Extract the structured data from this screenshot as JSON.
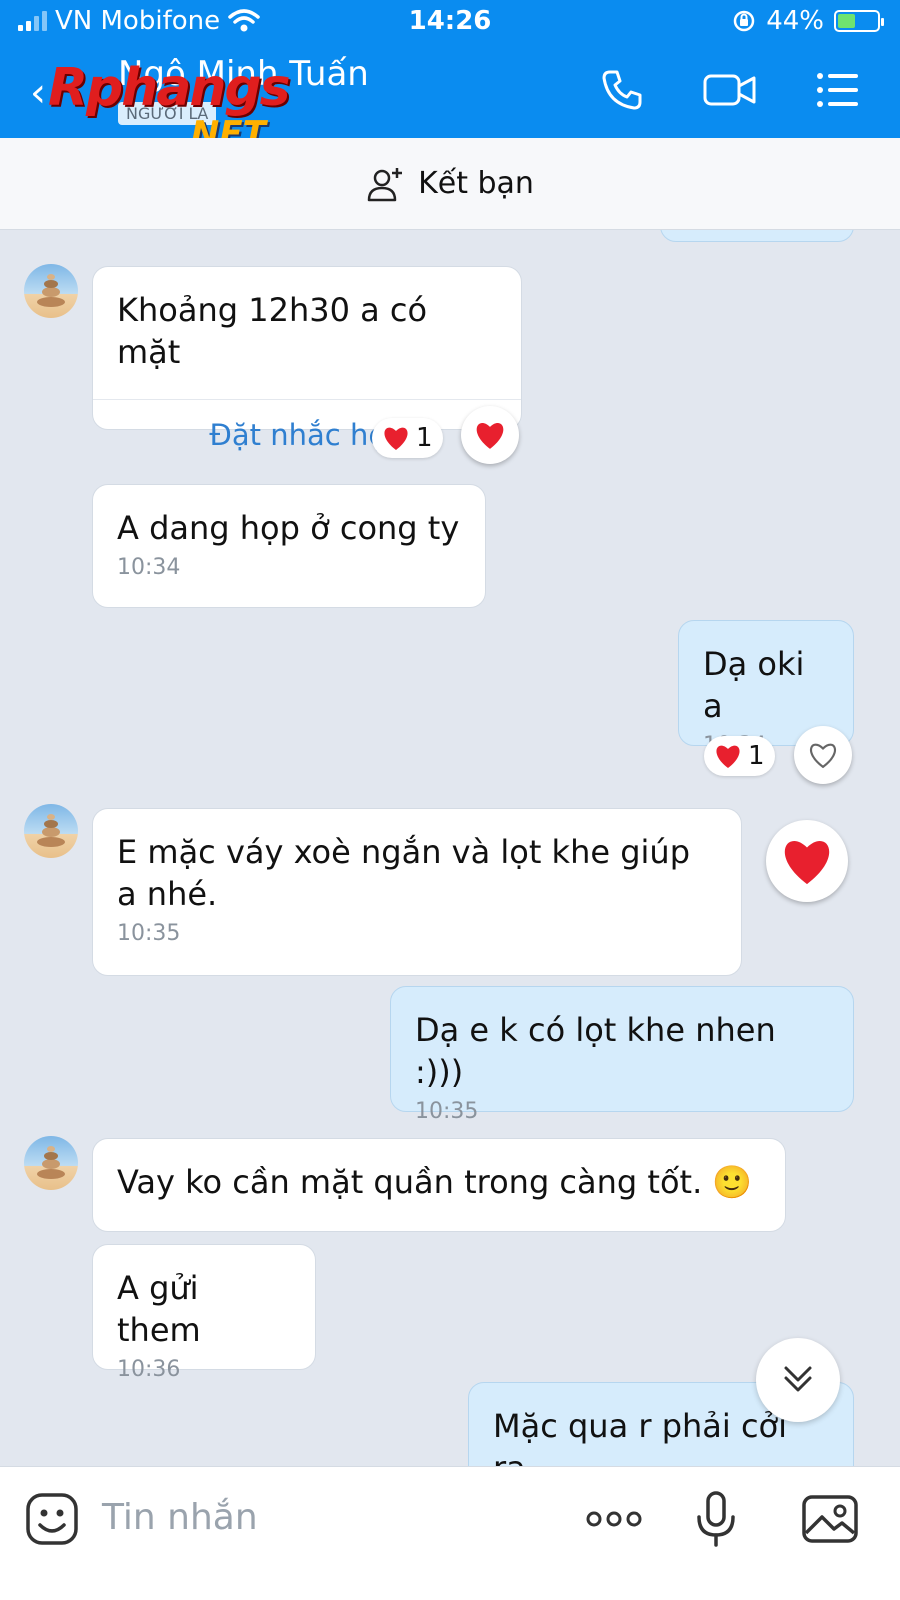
{
  "status_bar": {
    "carrier": "VN Mobifone",
    "time": "14:26",
    "battery": "44%",
    "battery_level": 0.44
  },
  "header": {
    "back_icon": "chevron-left-icon",
    "contact_name": "Ngô Minh Tuấn",
    "badge": "NGƯỜI LẠ",
    "watermark_main": "Rphangs",
    "watermark_sub": ".NET",
    "actions": [
      "phone-icon",
      "video-icon",
      "menu-icon"
    ]
  },
  "friend_bar": {
    "label": "Kết bạn",
    "icon": "add-friend-icon"
  },
  "messages": [
    {
      "side": "in",
      "text": "Khoảng 12h30 a có mặt",
      "reminder": "Đặt nhắc hẹn",
      "reaction_count": "1"
    },
    {
      "side": "in",
      "text": "A dang họp ở cong ty",
      "time": "10:34"
    },
    {
      "side": "out",
      "text": "Dạ oki a",
      "time": "10:34",
      "reaction_count": "1"
    },
    {
      "side": "in",
      "text": "E mặc váy xoè ngắn và lọt khe giúp a nhé.",
      "time": "10:35"
    },
    {
      "side": "out",
      "text": "Dạ e k có lọt khe nhen :)))",
      "time": "10:35"
    },
    {
      "side": "in",
      "text": "Vay ko cần mặt quần trong càng tốt. 🙂"
    },
    {
      "side": "in",
      "text": "A gửi them",
      "time": "10:36"
    },
    {
      "side": "out",
      "text": "Mặc qua r phải cởi ra"
    }
  ],
  "input_bar": {
    "placeholder": "Tin nhắn",
    "icons": [
      "sticker-icon",
      "more-icon",
      "microphone-icon",
      "image-icon"
    ]
  },
  "colors": {
    "header": "#0a8cf0",
    "incoming_bubble": "#ffffff",
    "outgoing_bubble": "#d6ecfc",
    "chat_bg": "#e2e7ef",
    "heart": "#e8202e"
  }
}
